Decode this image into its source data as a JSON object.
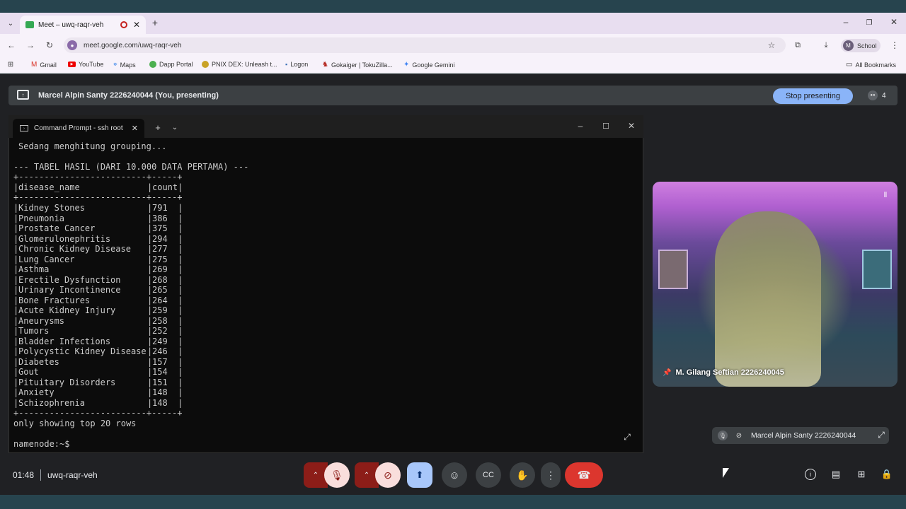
{
  "browser": {
    "tab_title": "Meet – uwq-raqr-veh",
    "url": "meet.google.com/uwq-raqr-veh",
    "profile_initial": "M",
    "profile_label": "School",
    "bookmarks": [
      "Gmail",
      "YouTube",
      "Maps",
      "Dapp Portal",
      "PNIX DEX: Unleash t...",
      "Logon",
      "Gokaiger | TokuZilla...",
      "Google Gemini"
    ],
    "all_bookmarks": "All Bookmarks"
  },
  "meet": {
    "presenter_text": "Marcel Alpin Santy 2226240044 (You, presenting)",
    "stop_presenting": "Stop presenting",
    "participant_count": "4",
    "time": "01:48",
    "meeting_code": "uwq-raqr-veh",
    "video_name": "M. Gilang Seftian 2226240045",
    "self_name": "Marcel Alpin Santy 2226240044"
  },
  "terminal": {
    "tab_label": "Command Prompt - ssh  root",
    "status_line": "Sedang menghitung grouping...",
    "table_title": "--- TABEL HASIL (DARI 10.000 DATA PERTAMA) ---",
    "border": "+-------------------------+-----+",
    "headers": [
      "disease_name",
      "count"
    ],
    "rows": [
      [
        "Kidney Stones",
        "791"
      ],
      [
        "Pneumonia",
        "386"
      ],
      [
        "Prostate Cancer",
        "375"
      ],
      [
        "Glomerulonephritis",
        "294"
      ],
      [
        "Chronic Kidney Disease",
        "277"
      ],
      [
        "Lung Cancer",
        "275"
      ],
      [
        "Asthma",
        "269"
      ],
      [
        "Erectile Dysfunction",
        "268"
      ],
      [
        "Urinary Incontinence",
        "265"
      ],
      [
        "Bone Fractures",
        "264"
      ],
      [
        "Acute Kidney Injury",
        "259"
      ],
      [
        "Aneurysms",
        "258"
      ],
      [
        "Tumors",
        "252"
      ],
      [
        "Bladder Infections",
        "249"
      ],
      [
        "Polycystic Kidney Disease",
        "246"
      ],
      [
        "Diabetes",
        "157"
      ],
      [
        "Gout",
        "154"
      ],
      [
        "Pituitary Disorders",
        "151"
      ],
      [
        "Anxiety",
        "148"
      ],
      [
        "Schizophrenia",
        "148"
      ]
    ],
    "footer_note": "only showing top 20 rows",
    "prompt": "namenode:~$"
  }
}
